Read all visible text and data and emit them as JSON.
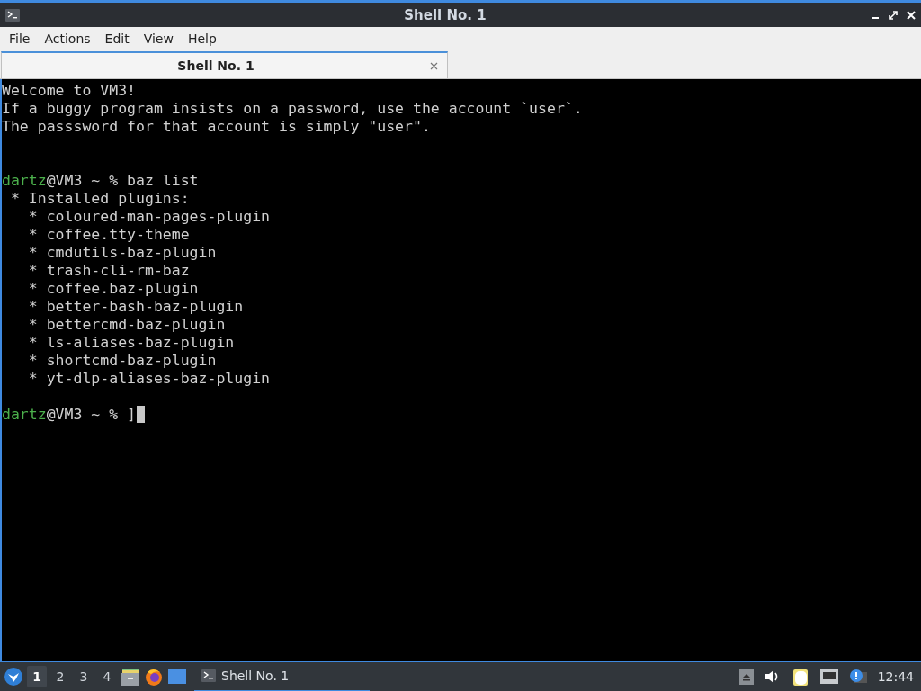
{
  "window": {
    "title": "Shell No. 1"
  },
  "menu": [
    "File",
    "Actions",
    "Edit",
    "View",
    "Help"
  ],
  "tabs": [
    {
      "label": "Shell No. 1",
      "selected": true
    }
  ],
  "terminal": {
    "lines": [
      {
        "kind": "text",
        "text": "Welcome to VM3!"
      },
      {
        "kind": "text",
        "text": "If a buggy program insists on a password, use the account `user`."
      },
      {
        "kind": "text",
        "text": "The passsword for that account is simply \"user\"."
      },
      {
        "kind": "blank"
      },
      {
        "kind": "blank"
      },
      {
        "kind": "prompt",
        "user": "dartz",
        "rest": "@VM3 ~ % baz list"
      },
      {
        "kind": "text",
        "text": " * Installed plugins:"
      },
      {
        "kind": "text",
        "text": "   * coloured-man-pages-plugin"
      },
      {
        "kind": "text",
        "text": "   * coffee.tty-theme"
      },
      {
        "kind": "text",
        "text": "   * cmdutils-baz-plugin"
      },
      {
        "kind": "text",
        "text": "   * trash-cli-rm-baz"
      },
      {
        "kind": "text",
        "text": "   * coffee.baz-plugin"
      },
      {
        "kind": "text",
        "text": "   * better-bash-baz-plugin"
      },
      {
        "kind": "text",
        "text": "   * bettercmd-baz-plugin"
      },
      {
        "kind": "text",
        "text": "   * ls-aliases-baz-plugin"
      },
      {
        "kind": "text",
        "text": "   * shortcmd-baz-plugin"
      },
      {
        "kind": "text",
        "text": "   * yt-dlp-aliases-baz-plugin"
      },
      {
        "kind": "blank"
      },
      {
        "kind": "prompt",
        "user": "dartz",
        "rest": "@VM3 ~ % ]",
        "cursor": true
      }
    ]
  },
  "taskbar": {
    "workspaces": [
      {
        "label": "1",
        "selected": true
      },
      {
        "label": "2",
        "selected": false
      },
      {
        "label": "3",
        "selected": false
      },
      {
        "label": "4",
        "selected": false
      }
    ],
    "tasks": [
      {
        "label": "Shell No. 1",
        "selected": true
      }
    ],
    "clock": "12:44"
  }
}
